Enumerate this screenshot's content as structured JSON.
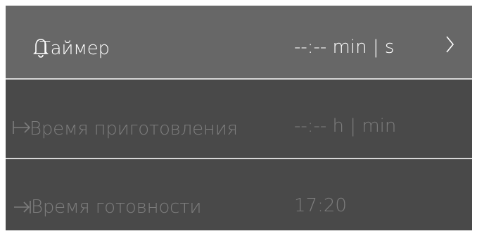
{
  "settings": {
    "rows": [
      {
        "icon": "bell-icon",
        "label": "Таймер",
        "value": "--:--  min | s",
        "chevron": "chevron-right-icon",
        "state": "active"
      },
      {
        "icon": "arrow-to-bar-icon",
        "label": "Время приготовления",
        "value": "--:--  h | min",
        "state": "disabled"
      },
      {
        "icon": "arrow-bar-end-icon",
        "label": "Время готовности",
        "value": "17:20",
        "state": "disabled"
      }
    ]
  },
  "colors": {
    "active_row_bg": "#676767",
    "panel_bg": "#494949",
    "active_text": "#ffffff",
    "disabled_text": "#7d7d7d",
    "divider": "#d6d6d6"
  }
}
